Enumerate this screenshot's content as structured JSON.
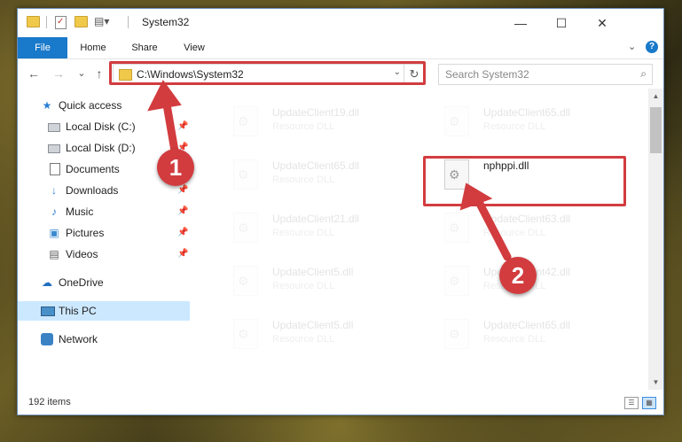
{
  "window": {
    "title": "System32",
    "minimize_glyph": "—",
    "maximize_glyph": "☐",
    "close_glyph": "✕"
  },
  "ribbon": {
    "tabs": [
      {
        "label": "File"
      },
      {
        "label": "Home"
      },
      {
        "label": "Share"
      },
      {
        "label": "View"
      }
    ],
    "expand_glyph": "⌄",
    "help_glyph": "?"
  },
  "navigation": {
    "back_glyph": "←",
    "forward_glyph": "→",
    "recent_glyph": "⌄",
    "up_glyph": "↑",
    "address": "C:\\Windows\\System32",
    "address_dropdown_glyph": "⌄",
    "refresh_glyph": "↻",
    "search_placeholder": "Search System32",
    "search_glyph": "⌕"
  },
  "sidebar": {
    "items": [
      {
        "label": "Quick access",
        "icon": "star-icon",
        "glyph": "★",
        "pinned": false
      },
      {
        "label": "Local Disk (C:)",
        "icon": "drive-icon",
        "pinned": true
      },
      {
        "label": "Local Disk (D:)",
        "icon": "drive-icon",
        "pinned": true
      },
      {
        "label": "Documents",
        "icon": "documents-icon",
        "pinned": false
      },
      {
        "label": "Downloads",
        "icon": "download-icon",
        "glyph": "↓",
        "pinned": true
      },
      {
        "label": "Music",
        "icon": "music-icon",
        "glyph": "♪",
        "pinned": true
      },
      {
        "label": "Pictures",
        "icon": "pictures-icon",
        "glyph": "▣",
        "pinned": true
      },
      {
        "label": "Videos",
        "icon": "videos-icon",
        "glyph": "▤",
        "pinned": true
      },
      {
        "label": "OneDrive",
        "icon": "cloud-icon",
        "glyph": "☁",
        "pinned": false
      },
      {
        "label": "This PC",
        "icon": "pc-icon",
        "pinned": false,
        "selected": true
      },
      {
        "label": "Network",
        "icon": "network-icon",
        "pinned": false
      }
    ],
    "pin_glyph": "📌"
  },
  "files": [
    {
      "name": "UpdateClient19.dll",
      "type": "Resource DLL",
      "faded": true
    },
    {
      "name": "UpdateClient65.dll",
      "type": "Resource DLL",
      "faded": true
    },
    {
      "name": "UpdateClient65.dll",
      "type": "Resource DLL",
      "faded": true
    },
    {
      "name": "nphppi.dll",
      "type": "",
      "faded": false
    },
    {
      "name": "UpdateClient21.dll",
      "type": "Resource DLL",
      "faded": true
    },
    {
      "name": "UpdateClient63.dll",
      "type": "Resource DLL",
      "faded": true
    },
    {
      "name": "UpdateClient5.dll",
      "type": "Resource DLL",
      "faded": true
    },
    {
      "name": "UpdateClient42.dll",
      "type": "Resource DLL",
      "faded": true
    },
    {
      "name": "UpdateClient5.dll",
      "type": "Resource DLL",
      "faded": true
    },
    {
      "name": "UpdateClient65.dll",
      "type": "Resource DLL",
      "faded": true
    }
  ],
  "status": {
    "item_count": "192 items",
    "details_view_glyph": "☰",
    "large_icons_glyph": "▦"
  },
  "callouts": [
    {
      "number": "1"
    },
    {
      "number": "2"
    }
  ],
  "colors": {
    "highlight_red": "#d23c3f",
    "file_tab_blue": "#1979ca",
    "selection_blue": "#cce8ff"
  },
  "scrollbar": {
    "up_glyph": "▲",
    "down_glyph": "▼"
  }
}
